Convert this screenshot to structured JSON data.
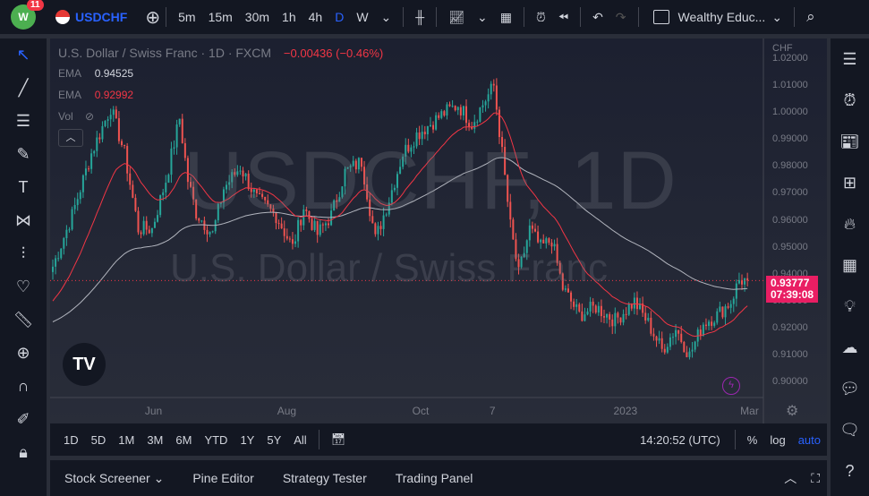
{
  "header": {
    "notifications": "11",
    "symbol": "USDCHF",
    "intervals": [
      "5m",
      "15m",
      "30m",
      "1h",
      "4h",
      "D",
      "W"
    ],
    "active_interval": "D",
    "layout_name": "Wealthy Educ..."
  },
  "legend": {
    "title": "U.S. Dollar / Swiss Franc · 1D · FXCM",
    "change": "−0.00436 (−0.46%)",
    "ema1_label": "EMA",
    "ema1_value": "0.94525",
    "ema2_label": "EMA",
    "ema2_value": "0.92992",
    "vol_label": "Vol"
  },
  "watermark": {
    "symbol": "USDCHF, 1D",
    "name": "U.S. Dollar / Swiss Franc"
  },
  "axis": {
    "currency": "CHF",
    "current_price": "0.93777",
    "countdown": "07:39:08"
  },
  "bottom": {
    "ranges": [
      "1D",
      "5D",
      "1M",
      "3M",
      "6M",
      "YTD",
      "1Y",
      "5Y",
      "All"
    ],
    "time": "14:20:52 (UTC)",
    "pct": "%",
    "log": "log",
    "auto": "auto"
  },
  "panel": {
    "tabs": [
      "Stock Screener",
      "Pine Editor",
      "Strategy Tester",
      "Trading Panel"
    ]
  },
  "colors": {
    "up": "#26a69a",
    "down": "#ef5350",
    "ema_fast": "#f23645",
    "ema_slow": "#b2b5be",
    "accent": "#2962ff"
  },
  "chart_data": {
    "type": "candlestick",
    "title": "U.S. Dollar / Swiss Franc · 1D · FXCM",
    "ylim": [
      0.895,
      1.023
    ],
    "yticks": [
      1.02,
      1.01,
      1.0,
      0.99,
      0.98,
      0.97,
      0.96,
      0.95,
      0.94,
      0.93,
      0.92,
      0.91,
      0.9
    ],
    "xticks": [
      {
        "label": "Jun",
        "i": 36
      },
      {
        "label": "Aug",
        "i": 84
      },
      {
        "label": "Oct",
        "i": 133
      },
      {
        "label": "7",
        "i": 161
      },
      {
        "label": "2023",
        "i": 206
      },
      {
        "label": "Mar",
        "i": 252
      }
    ],
    "anchors": [
      [
        0,
        0.943
      ],
      [
        7,
        0.962
      ],
      [
        14,
        0.985
      ],
      [
        21,
        1.002
      ],
      [
        26,
        0.985
      ],
      [
        31,
        0.957
      ],
      [
        36,
        0.957
      ],
      [
        41,
        0.975
      ],
      [
        46,
        0.998
      ],
      [
        49,
        0.975
      ],
      [
        52,
        0.963
      ],
      [
        58,
        0.955
      ],
      [
        62,
        0.972
      ],
      [
        68,
        0.98
      ],
      [
        74,
        0.968
      ],
      [
        81,
        0.962
      ],
      [
        87,
        0.95
      ],
      [
        91,
        0.965
      ],
      [
        96,
        0.955
      ],
      [
        101,
        0.962
      ],
      [
        106,
        0.978
      ],
      [
        112,
        0.982
      ],
      [
        117,
        0.953
      ],
      [
        122,
        0.968
      ],
      [
        127,
        0.985
      ],
      [
        132,
        0.992
      ],
      [
        137,
        0.996
      ],
      [
        142,
        1.0
      ],
      [
        147,
        1.003
      ],
      [
        152,
        0.996
      ],
      [
        157,
        1.005
      ],
      [
        160,
        1.01
      ],
      [
        163,
        0.985
      ],
      [
        166,
        0.958
      ],
      [
        169,
        0.94
      ],
      [
        173,
        0.957
      ],
      [
        177,
        0.95
      ],
      [
        181,
        0.953
      ],
      [
        185,
        0.935
      ],
      [
        191,
        0.925
      ],
      [
        197,
        0.928
      ],
      [
        204,
        0.923
      ],
      [
        211,
        0.93
      ],
      [
        216,
        0.922
      ],
      [
        221,
        0.912
      ],
      [
        226,
        0.92
      ],
      [
        231,
        0.91
      ],
      [
        236,
        0.922
      ],
      [
        241,
        0.925
      ],
      [
        246,
        0.93
      ],
      [
        249,
        0.938
      ],
      [
        252,
        0.9378
      ]
    ],
    "ema_fast_start": 0.929,
    "ema_slow_start": 0.922,
    "ema_fast_period": 50,
    "ema_slow_period": 200,
    "current": 0.93777
  }
}
